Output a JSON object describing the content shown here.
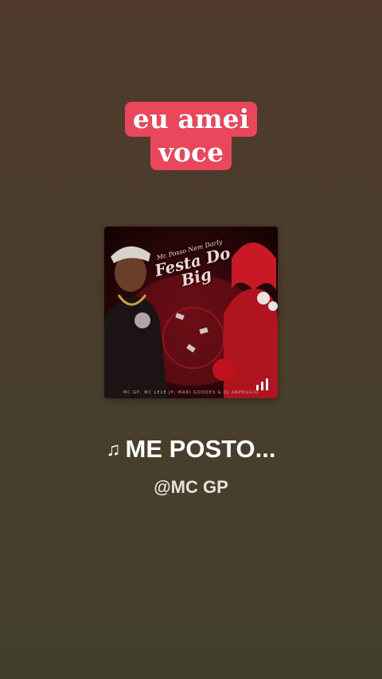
{
  "sticker": {
    "line1": "eu amei",
    "line2": "voce",
    "background_color": "#e8475c"
  },
  "album_cover": {
    "title": "Festa Do Big",
    "subtitle": "Mc Posso Nem Darly",
    "credits": "MC GP, MC LELE JP, MARI GOODES & DJ ARPEGGIO",
    "overlay_icon": "equalizer-bars-icon"
  },
  "track": {
    "note_icon": "♫",
    "title": "ME POSTO...",
    "artist": "@MC GP"
  }
}
